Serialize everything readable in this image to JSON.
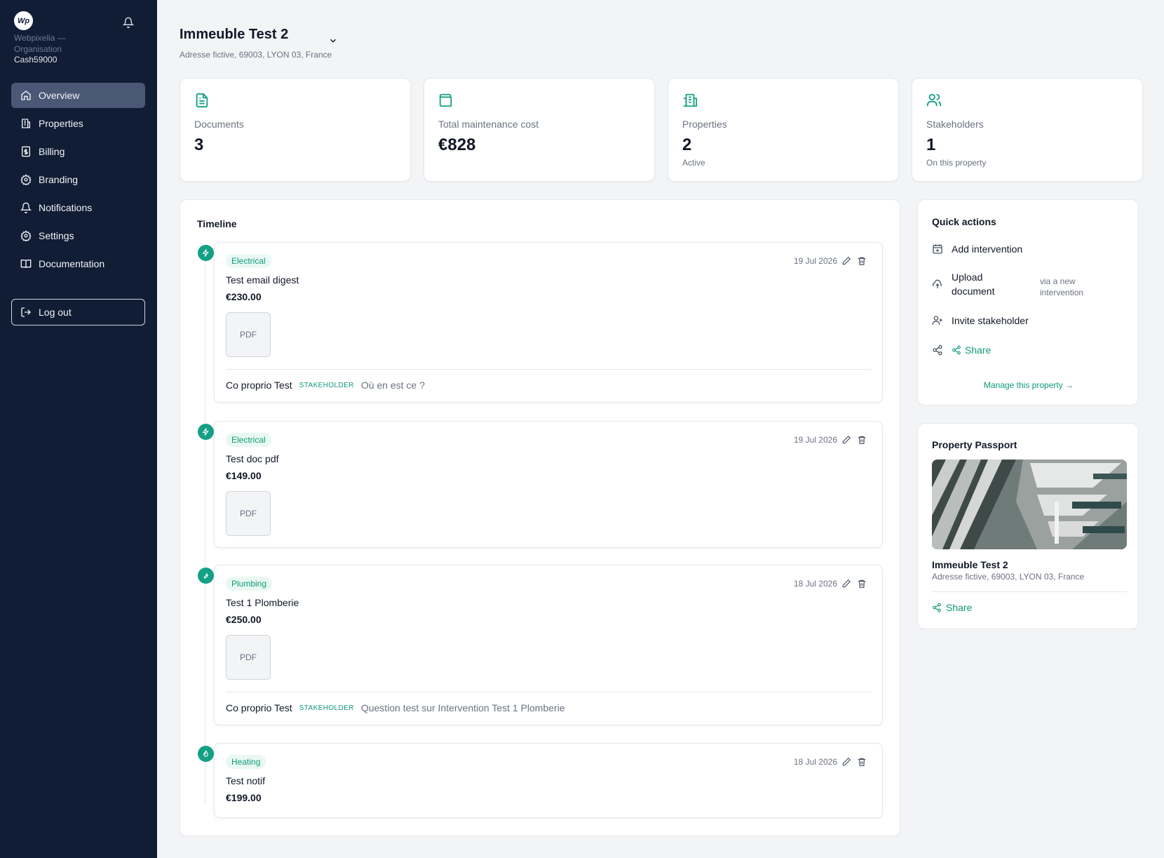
{
  "sidebar": {
    "logo_text": "Wp",
    "org_name": "Webpixelia — Organisation",
    "org_id": "Cash59000",
    "nav": [
      {
        "label": "Overview",
        "icon": "home-icon",
        "active": true
      },
      {
        "label": "Properties",
        "icon": "building-icon"
      },
      {
        "label": "Billing",
        "icon": "dollar-doc-icon"
      },
      {
        "label": "Branding",
        "icon": "gear-icon"
      },
      {
        "label": "Notifications",
        "icon": "bell-icon"
      },
      {
        "label": "Settings",
        "icon": "gear-icon"
      },
      {
        "label": "Documentation",
        "icon": "book-icon"
      }
    ],
    "logout_label": "Log out"
  },
  "header": {
    "title": "Immeuble Test 2",
    "address": "Adresse fictive, 69003, LYON 03, France"
  },
  "stats": [
    {
      "label": "Documents",
      "value": "3",
      "sub": "",
      "icon": "document-icon"
    },
    {
      "label": "Total maintenance cost",
      "value": "€828",
      "sub": "",
      "icon": "wallet-icon"
    },
    {
      "label": "Properties",
      "value": "2",
      "sub": "Active",
      "icon": "building-icon"
    },
    {
      "label": "Stakeholders",
      "value": "1",
      "sub": "On this property",
      "icon": "users-icon"
    }
  ],
  "timeline": {
    "title": "Timeline",
    "pdf_label": "PDF",
    "entries": [
      {
        "tag": "Electrical",
        "date": "19 Jul 2026",
        "name": "Test email digest",
        "amount": "€230.00",
        "comment": {
          "author": "Co proprio Test",
          "role": "STAKEHOLDER",
          "text": "Où en est ce ?"
        }
      },
      {
        "tag": "Electrical",
        "date": "19 Jul 2026",
        "name": "Test doc pdf",
        "amount": "€149.00"
      },
      {
        "tag": "Plumbing",
        "date": "18 Jul 2026",
        "name": "Test 1 Plomberie",
        "amount": "€250.00",
        "comment": {
          "author": "Co proprio Test",
          "role": "STAKEHOLDER",
          "text": "Question test sur Intervention Test 1 Plomberie"
        }
      },
      {
        "tag": "Heating",
        "date": "18 Jul 2026",
        "name": "Test notif",
        "amount": "€199.00"
      }
    ]
  },
  "quick_actions": {
    "title": "Quick actions",
    "add_intervention": "Add intervention",
    "upload_document": "Upload document",
    "upload_note": "via a new intervention",
    "invite_stakeholder": "Invite stakeholder",
    "share": "Share",
    "manage": "Manage this property →"
  },
  "passport": {
    "title": "Property Passport",
    "name": "Immeuble Test 2",
    "address": "Adresse fictive, 69003, LYON 03, France",
    "share": "Share"
  },
  "colors": {
    "accent": "#14a085",
    "sidebar": "#101d35"
  }
}
